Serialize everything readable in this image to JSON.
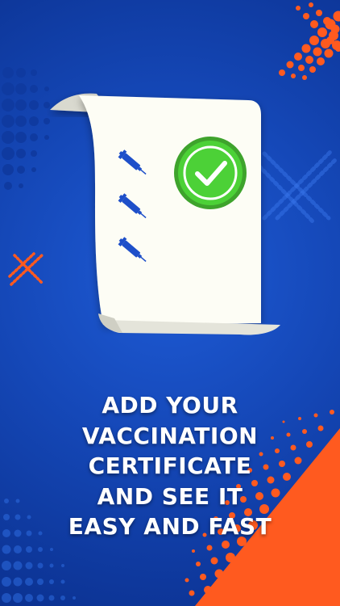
{
  "screen": {
    "headline_lines": [
      "ADD YOUR",
      "VACCINATION",
      "CERTIFICATE",
      "AND SEE IT",
      "EASY AND FAST"
    ]
  },
  "illustration": {
    "document": "certificate-scroll",
    "status_icon": "checkmark-circle-icon",
    "list_icons": [
      "syringe-icon",
      "syringe-icon",
      "syringe-icon"
    ]
  },
  "colors": {
    "background": "#1548b8",
    "accent_orange": "#ff5a1f",
    "check_green": "#4cd137",
    "syringe_blue": "#1e4fc9",
    "paper": "#fdfdf5"
  }
}
